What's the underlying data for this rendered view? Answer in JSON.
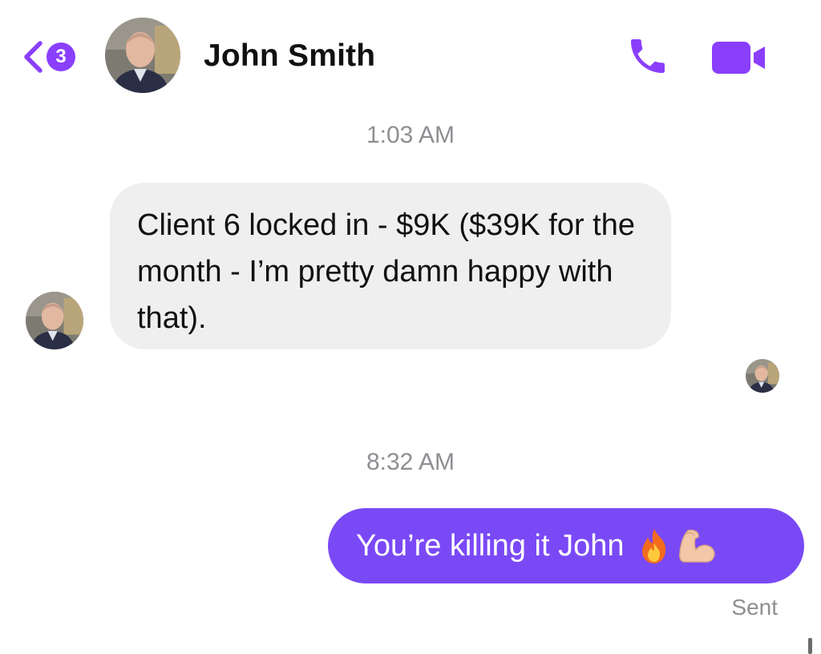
{
  "header": {
    "back_badge_count": "3",
    "contact_name": "John Smith",
    "accent_color": "#8a3ffc"
  },
  "messages": [
    {
      "timestamp": "1:03 AM",
      "direction": "incoming",
      "text": "Client 6 locked in - $9K ($39K for the month - I’m pretty damn happy with that)."
    },
    {
      "timestamp": "8:32 AM",
      "direction": "outgoing",
      "text": "You’re killing it John",
      "emojis": [
        "fire-emoji",
        "flexed-biceps-emoji"
      ],
      "status": "Sent"
    }
  ],
  "colors": {
    "incoming_bubble": "#efefef",
    "outgoing_bubble": "#7a49f6",
    "meta_text": "#8e8e93"
  },
  "icons": [
    "back-chevron-icon",
    "phone-icon",
    "video-camera-icon"
  ]
}
